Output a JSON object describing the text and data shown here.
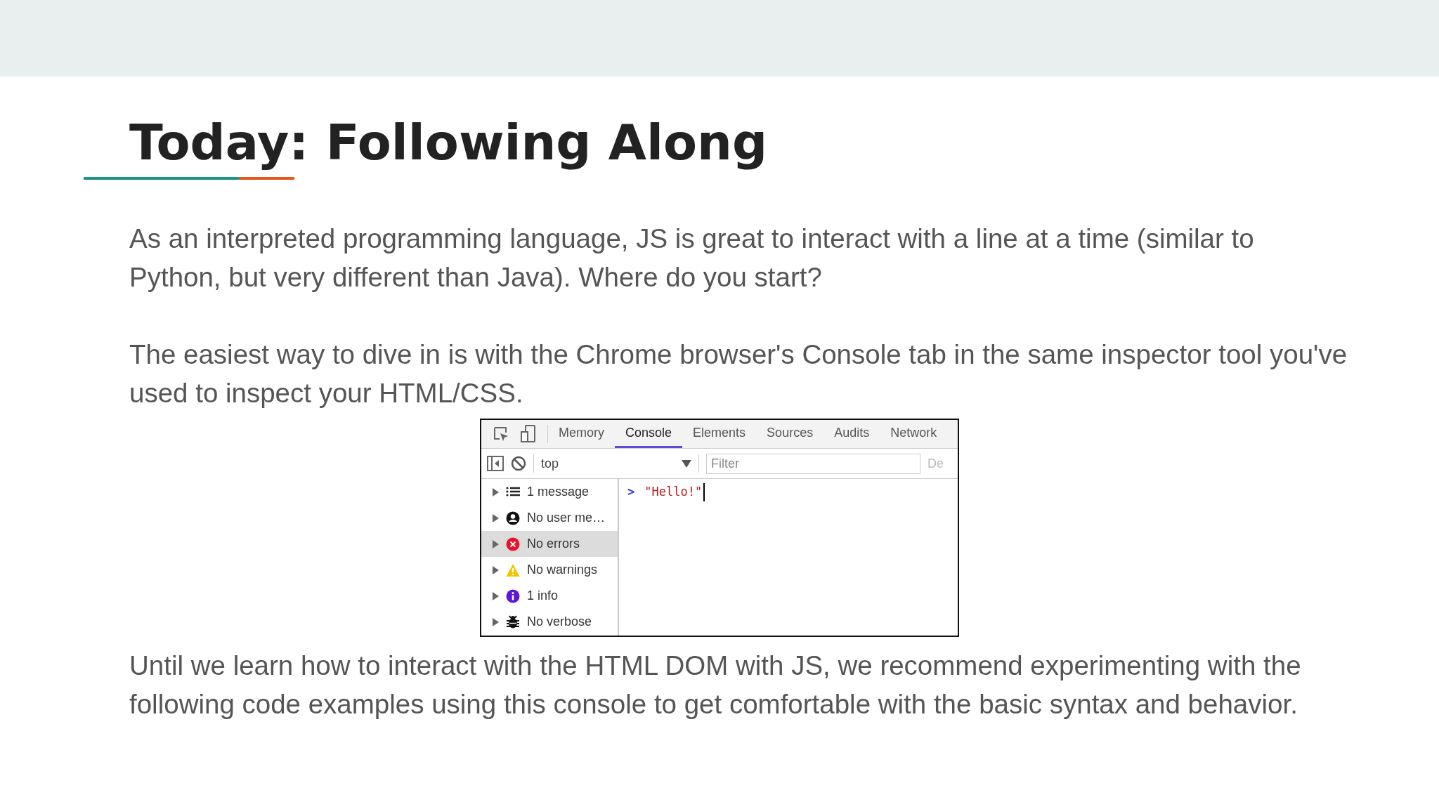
{
  "title": "Today: Following Along",
  "paragraphs_before": [
    "As an interpreted programming language, JS is great to interact with a line at a time (similar to Python, but very different than Java). Where do you start?",
    "The easiest way to dive in is with the Chrome browser's Console tab in the same inspector tool you've used to inspect your HTML/CSS."
  ],
  "devtools": {
    "tabs": [
      {
        "label": "Memory",
        "selected": false
      },
      {
        "label": "Console",
        "selected": true
      },
      {
        "label": "Elements",
        "selected": false
      },
      {
        "label": "Sources",
        "selected": false
      },
      {
        "label": "Audits",
        "selected": false
      },
      {
        "label": "Network",
        "selected": false
      }
    ],
    "context": "top",
    "filter_placeholder": "Filter",
    "cut_label": "De",
    "sidebar": [
      {
        "kind": "message",
        "label": "1 message",
        "selected": false
      },
      {
        "kind": "user",
        "label": "No user me…",
        "selected": false
      },
      {
        "kind": "error",
        "label": "No errors",
        "selected": true
      },
      {
        "kind": "warning",
        "label": "No warnings",
        "selected": false
      },
      {
        "kind": "info",
        "label": "1 info",
        "selected": false
      },
      {
        "kind": "verbose",
        "label": "No verbose",
        "selected": false
      }
    ],
    "prompt": ">",
    "input": "\"Hello!\""
  },
  "paragraphs_after": [
    "Until we learn how to interact with the HTML DOM with JS, we recommend experimenting with the following code examples using this console to get comfortable with the basic syntax and behavior."
  ]
}
